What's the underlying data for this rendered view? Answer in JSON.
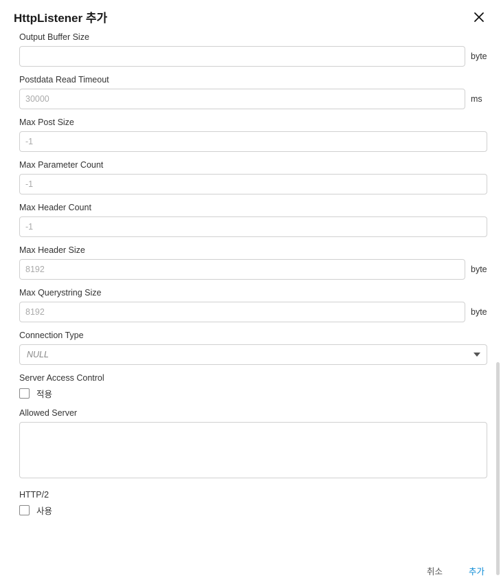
{
  "dialog": {
    "title": "HttpListener 추가"
  },
  "fields": {
    "output_buffer_size": {
      "label": "Output Buffer Size",
      "value": "",
      "unit": "byte"
    },
    "postdata_read_timeout": {
      "label": "Postdata Read Timeout",
      "placeholder": "30000",
      "value": "",
      "unit": "ms"
    },
    "max_post_size": {
      "label": "Max Post Size",
      "placeholder": "-1",
      "value": ""
    },
    "max_parameter_count": {
      "label": "Max Parameter Count",
      "placeholder": "-1",
      "value": ""
    },
    "max_header_count": {
      "label": "Max Header Count",
      "placeholder": "-1",
      "value": ""
    },
    "max_header_size": {
      "label": "Max Header Size",
      "placeholder": "8192",
      "value": "",
      "unit": "byte"
    },
    "max_querystring_size": {
      "label": "Max Querystring Size",
      "placeholder": "8192",
      "value": "",
      "unit": "byte"
    },
    "connection_type": {
      "label": "Connection Type",
      "selected": "NULL"
    },
    "server_access_control": {
      "label": "Server Access Control",
      "checkbox_label": "적용",
      "checked": false
    },
    "allowed_server": {
      "label": "Allowed Server",
      "value": ""
    },
    "http2": {
      "label": "HTTP/2",
      "checkbox_label": "사용",
      "checked": false
    }
  },
  "footer": {
    "cancel": "취소",
    "submit": "추가"
  }
}
